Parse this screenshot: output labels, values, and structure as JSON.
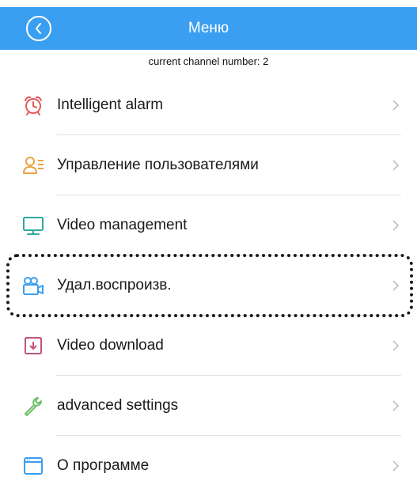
{
  "header": {
    "title": "Меню",
    "back_icon": "chevron-left-circle-icon",
    "color": "#3a9ff0"
  },
  "channel_info": "current channel number: 2",
  "menu": {
    "items": [
      {
        "label": "Intelligent alarm",
        "icon": "alarm-clock-icon",
        "icon_color": "#e55a5a"
      },
      {
        "label": "Управление пользователями",
        "icon": "users-list-icon",
        "icon_color": "#e9a244"
      },
      {
        "label": "Video management",
        "icon": "monitor-icon",
        "icon_color": "#2fa99b"
      },
      {
        "label": "Удал.воспроизв.",
        "icon": "video-camera-icon",
        "icon_color": "#3a9ff0"
      },
      {
        "label": "Video download",
        "icon": "download-icon",
        "icon_color": "#c2557a"
      },
      {
        "label": "advanced settings",
        "icon": "wrench-icon",
        "icon_color": "#6fbf6a"
      },
      {
        "label": "О программе",
        "icon": "window-icon",
        "icon_color": "#3a9ff0"
      }
    ]
  }
}
